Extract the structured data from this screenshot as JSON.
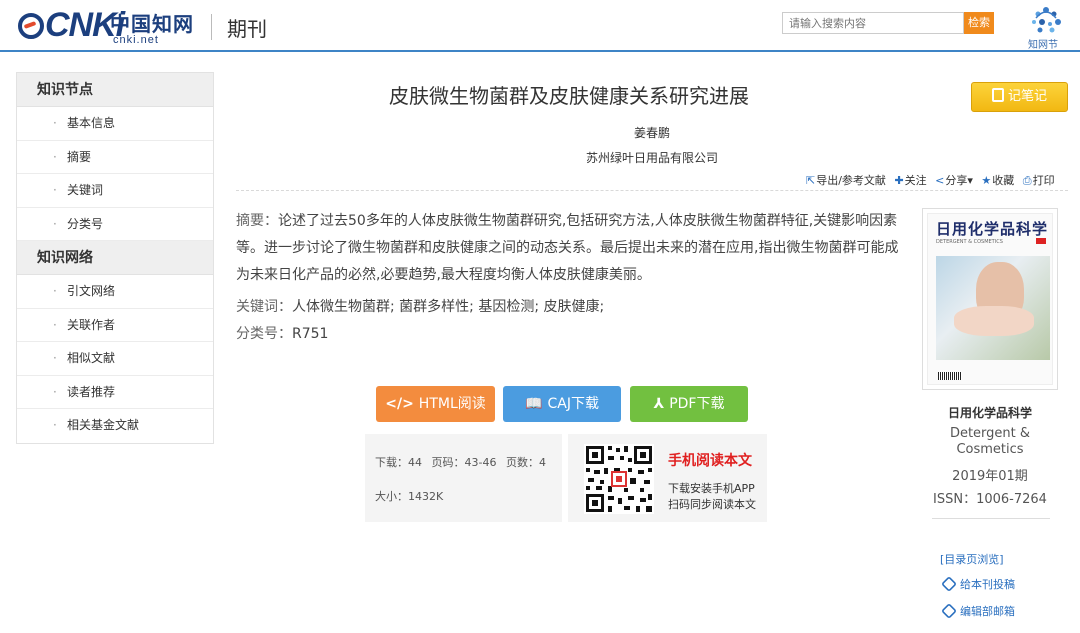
{
  "header": {
    "logo_cnki": "CNKi",
    "logo_cn": "中国知网",
    "logo_url": "cnki.net",
    "section": "期刊",
    "search_placeholder": "请输入搜索内容",
    "search_button": "检索",
    "zhiwang_text": "知网节"
  },
  "sidebar": {
    "group1": "知识节点",
    "items1": [
      "基本信息",
      "摘要",
      "关键词",
      "分类号"
    ],
    "group2": "知识网络",
    "items2": [
      "引文网络",
      "关联作者",
      "相似文献",
      "读者推荐",
      "相关基金文献"
    ]
  },
  "article": {
    "title": "皮肤微生物菌群及皮肤健康关系研究进展",
    "note_button": "记笔记",
    "author": "姜春鹏",
    "organization": "苏州绿叶日用品有限公司",
    "actions": [
      "导出/参考文献",
      "关注",
      "分享",
      "收藏",
      "打印"
    ],
    "abstract_label": "摘要：",
    "abstract_text": "论述了过去50多年的人体皮肤微生物菌群研究,包括研究方法,人体皮肤微生物菌群特征,关键影响因素等。进一步讨论了微生物菌群和皮肤健康之间的动态关系。最后提出未来的潜在应用,指出微生物菌群可能成为未来日化产品的必然,必要趋势,最大程度均衡人体皮肤健康美丽。",
    "keywords_label": "关键词：",
    "keywords": "人体微生物菌群; 菌群多样性; 基因检测; 皮肤健康;",
    "class_label": "分类号：",
    "class_value": "R751"
  },
  "downloads": {
    "html": "HTML阅读",
    "caj": "CAJ下载",
    "pdf": "PDF下载"
  },
  "stats": {
    "downloads": "下载：44",
    "pages_range": "页码：43-46",
    "page_count": "页数：4",
    "size": "大小：1432K"
  },
  "mobile": {
    "title": "手机阅读本文",
    "line1": "下载安装手机APP",
    "line2": "扫码同步阅读本文"
  },
  "journal": {
    "cover_title": "日用化学品科学",
    "cover_en": "DETERGENT & COSMETICS",
    "name": "日用化学品科学",
    "en_name": "Detergent & Cosmetics",
    "issue": "2019年01期",
    "issn": "ISSN：1006-7264",
    "link_toc": "[目录页浏览]",
    "link_submit": "给本刊投稿",
    "link_editor": "编辑部邮箱"
  },
  "colors": {
    "header_rule": "#3d84c6",
    "html_button": "#f38c3e",
    "caj_button": "#4b9ce0",
    "pdf_button": "#72c040",
    "note_button": "#f2b812",
    "mobile_title": "#e02020"
  }
}
